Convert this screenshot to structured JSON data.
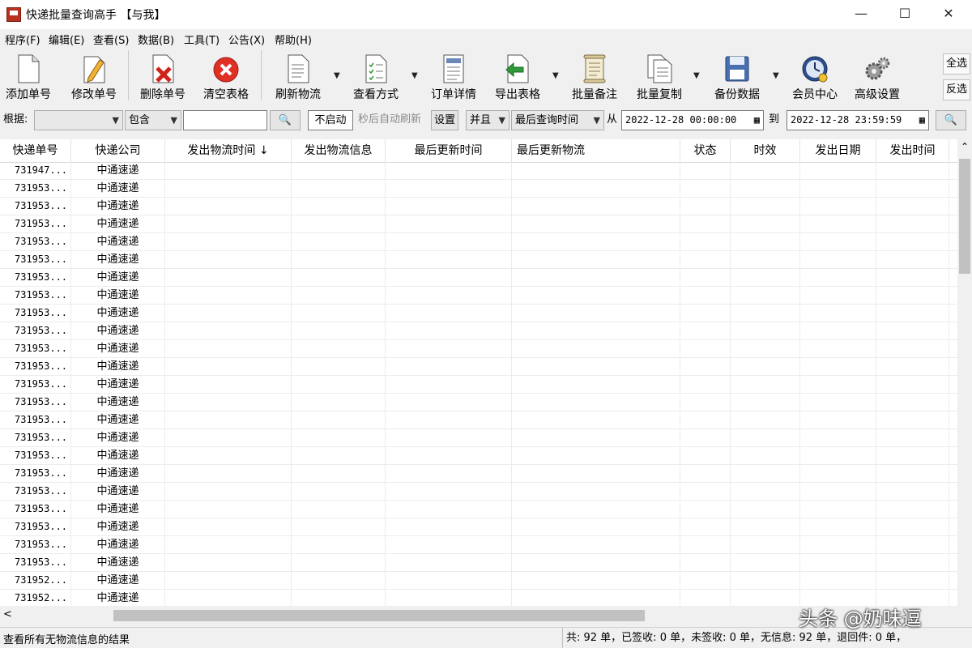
{
  "window": {
    "title": "快递批量查询高手 【与我】",
    "min_glyph": "—",
    "max_glyph": "☐",
    "close_glyph": "✕"
  },
  "menu": [
    "程序(F)",
    "编辑(E)",
    "查看(S)",
    "数据(B)",
    "工具(T)",
    "公告(X)",
    "帮助(H)"
  ],
  "toolbar": {
    "add": "添加单号",
    "edit": "修改单号",
    "delete": "删除单号",
    "clear": "清空表格",
    "refresh": "刷新物流",
    "view_mode": "查看方式",
    "order_detail": "订单详情",
    "export": "导出表格",
    "batch_note": "批量备注",
    "batch_copy": "批量复制",
    "backup": "备份数据",
    "member": "会员中心",
    "advanced": "高级设置",
    "select_all": "全选",
    "invert": "反选",
    "arrow": "▼"
  },
  "filter": {
    "basis_label": "根据:",
    "field_value": "",
    "match_value": "包含",
    "keyword_value": "",
    "search_glyph": "🔍",
    "auto_refresh_state": "不启动",
    "auto_refresh_label": "秒后自动刷新",
    "settings": "设置",
    "logic": "并且",
    "time_field": "最后查询时间",
    "from_label": "从",
    "from_date": "2022-12-28 00:00:00",
    "to_label": "到",
    "to_date": "2022-12-28 23:59:59",
    "dd": "▼",
    "cal": "▦"
  },
  "table": {
    "columns": [
      "快递单号",
      "快递公司",
      "发出物流时间 ↓",
      "发出物流信息",
      "最后更新时间",
      "最后更新物流",
      "状态",
      "时效",
      "发出日期",
      "发出时间"
    ],
    "rows": [
      [
        "731947...",
        "中通速递"
      ],
      [
        "731953...",
        "中通速递"
      ],
      [
        "731953...",
        "中通速递"
      ],
      [
        "731953...",
        "中通速递"
      ],
      [
        "731953...",
        "中通速递"
      ],
      [
        "731953...",
        "中通速递"
      ],
      [
        "731953...",
        "中通速递"
      ],
      [
        "731953...",
        "中通速递"
      ],
      [
        "731953...",
        "中通速递"
      ],
      [
        "731953...",
        "中通速递"
      ],
      [
        "731953...",
        "中通速递"
      ],
      [
        "731953...",
        "中通速递"
      ],
      [
        "731953...",
        "中通速递"
      ],
      [
        "731953...",
        "中通速递"
      ],
      [
        "731953...",
        "中通速递"
      ],
      [
        "731953...",
        "中通速递"
      ],
      [
        "731953...",
        "中通速递"
      ],
      [
        "731953...",
        "中通速递"
      ],
      [
        "731953...",
        "中通速递"
      ],
      [
        "731953...",
        "中通速递"
      ],
      [
        "731953...",
        "中通速递"
      ],
      [
        "731953...",
        "中通速递"
      ],
      [
        "731953...",
        "中通速递"
      ],
      [
        "731952...",
        "中通速递"
      ],
      [
        "731952...",
        "中通速递"
      ]
    ]
  },
  "scroll": {
    "up": "⌃",
    "left": "<"
  },
  "status": {
    "left": "查看所有无物流信息的结果",
    "right": "共: 92 单，已签收: 0 单，未签收: 0 单，无信息: 92 单，退回件: 0 单，"
  },
  "watermark": "头条 @奶味逗"
}
